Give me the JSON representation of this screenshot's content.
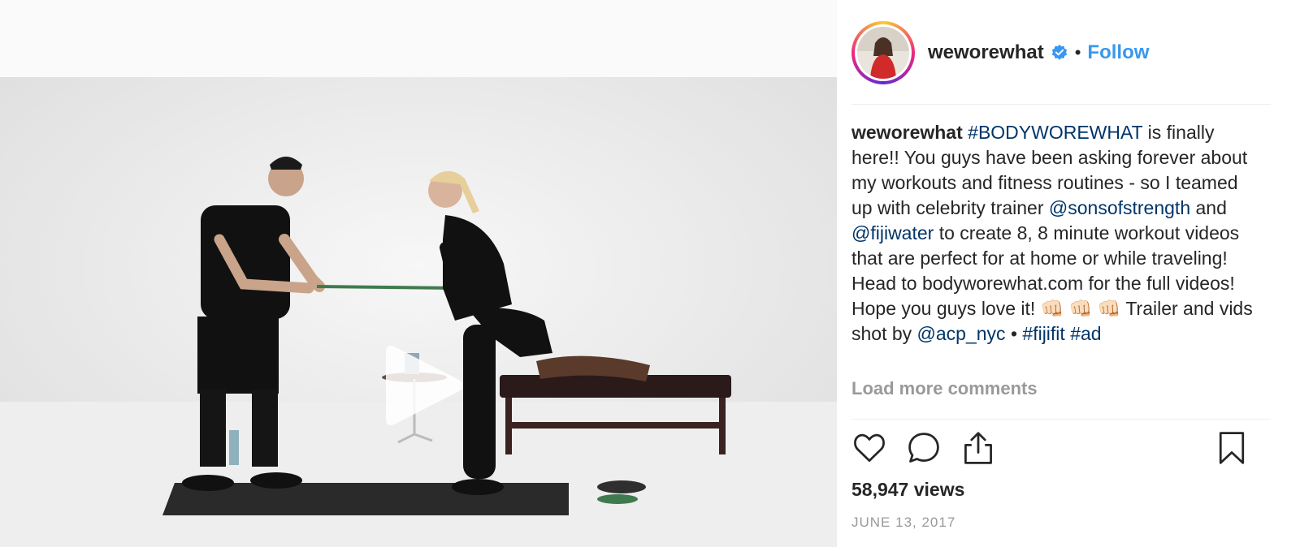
{
  "post": {
    "username": "weworewhat",
    "separator": "•",
    "follow_label": "Follow",
    "caption": {
      "username": "weworewhat",
      "segments": [
        {
          "text": " ",
          "type": "text"
        },
        {
          "text": "#BODYWOREWHAT",
          "type": "link"
        },
        {
          "text": " is finally here!! You guys have been asking forever about my workouts and fitness routines - so I teamed up with celebrity trainer ",
          "type": "text"
        },
        {
          "text": "@sonsofstrength",
          "type": "link"
        },
        {
          "text": " and ",
          "type": "text"
        },
        {
          "text": "@fijiwater",
          "type": "link"
        },
        {
          "text": " to create 8, 8 minute workout videos that are perfect for at home or while traveling! Head to bodyworewhat.com for the full videos! Hope you guys love it! 👊🏻 👊🏻 👊🏻 Trailer and vids shot by ",
          "type": "text"
        },
        {
          "text": "@acp_nyc",
          "type": "link"
        },
        {
          "text": " • ",
          "type": "text"
        },
        {
          "text": "#fijifit",
          "type": "link"
        },
        {
          "text": " ",
          "type": "text"
        },
        {
          "text": "#ad",
          "type": "link"
        }
      ]
    },
    "load_more_label": "Load more comments",
    "views": "58,947 views",
    "date": "JUNE 13, 2017"
  },
  "icons": {
    "verified": "verified-badge-icon",
    "like": "heart-icon",
    "comment": "comment-bubble-icon",
    "share": "share-upload-icon",
    "save": "bookmark-icon",
    "play": "play-icon"
  },
  "colors": {
    "link": "#003569",
    "follow": "#3897f0",
    "verified": "#3897f0",
    "muted": "#999999",
    "text": "#262626"
  }
}
